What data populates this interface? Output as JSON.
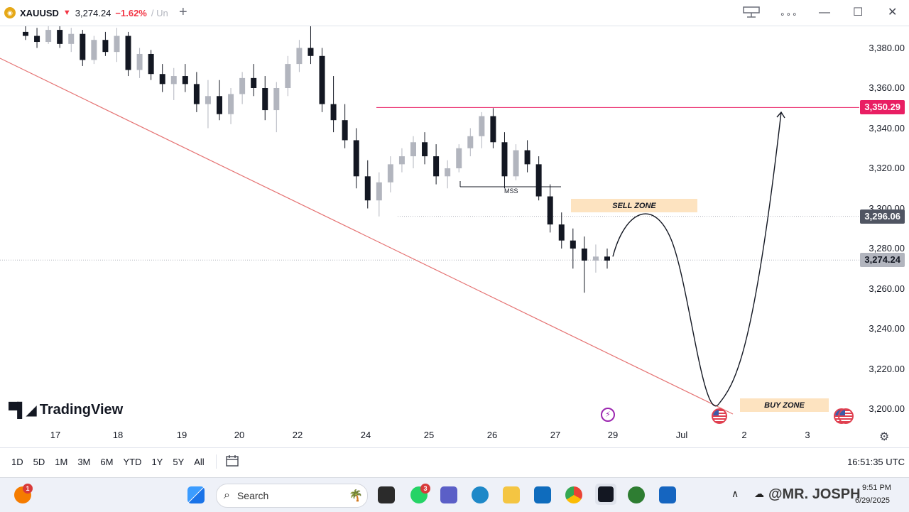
{
  "tab": {
    "symbol": "XAUUSD",
    "direction": "▼",
    "price": "3,274.24",
    "change": "−1.62%",
    "trailing": "/ Un",
    "new_tab": "+"
  },
  "window": {
    "layout_icon": "layout-icon",
    "more": "∘∘∘",
    "minimize": "—",
    "maximize": "☐",
    "close": "✕"
  },
  "chart": {
    "brand": "TradingView",
    "y_axis": {
      "min": 3190,
      "max": 3390,
      "ticks": [
        "3,380.00",
        "3,360.00",
        "3,340.00",
        "3,320.00",
        "3,300.00",
        "3,280.00",
        "3,260.00",
        "3,240.00",
        "3,220.00",
        "3,200.00"
      ],
      "tick_values": [
        3380,
        3360,
        3340,
        3320,
        3300,
        3280,
        3260,
        3240,
        3220,
        3200
      ]
    },
    "x_axis": {
      "labels": [
        "17",
        "18",
        "19",
        "20",
        "22",
        "24",
        "25",
        "26",
        "27",
        "29",
        "Jul",
        "2",
        "3"
      ]
    },
    "price_tags": {
      "resistance": {
        "text": "3,350.29",
        "value": 3350.29,
        "color": "#e91e63"
      },
      "target": {
        "text": "3,296.06",
        "value": 3296.06,
        "color": "#505562"
      },
      "last": {
        "text": "3,274.24",
        "value": 3274.24,
        "color": "#b2b5be"
      }
    },
    "annotations": {
      "sell_zone": "SELL ZONE",
      "buy_zone": "BUY ZONE",
      "mss": "MSS"
    }
  },
  "chart_data": {
    "type": "candlestick",
    "title": "",
    "symbol": "XAUUSD",
    "ylim": [
      3190,
      3390
    ],
    "horizontal_levels": [
      3350.29,
      3296.06,
      3274.24
    ],
    "candles_ohlc": [
      [
        3388,
        3392,
        3384,
        3386
      ],
      [
        3386,
        3390,
        3380,
        3383
      ],
      [
        3383,
        3392,
        3382,
        3389
      ],
      [
        3389,
        3391,
        3380,
        3382
      ],
      [
        3382,
        3390,
        3378,
        3387
      ],
      [
        3387,
        3389,
        3371,
        3374
      ],
      [
        3374,
        3386,
        3372,
        3384
      ],
      [
        3384,
        3388,
        3376,
        3378
      ],
      [
        3378,
        3390,
        3373,
        3386
      ],
      [
        3386,
        3388,
        3366,
        3369
      ],
      [
        3369,
        3380,
        3365,
        3377
      ],
      [
        3377,
        3379,
        3364,
        3367
      ],
      [
        3367,
        3372,
        3358,
        3362
      ],
      [
        3362,
        3370,
        3354,
        3366
      ],
      [
        3366,
        3372,
        3358,
        3362
      ],
      [
        3362,
        3368,
        3348,
        3352
      ],
      [
        3352,
        3364,
        3340,
        3356
      ],
      [
        3356,
        3364,
        3344,
        3347
      ],
      [
        3347,
        3360,
        3342,
        3357
      ],
      [
        3357,
        3368,
        3352,
        3365
      ],
      [
        3365,
        3372,
        3356,
        3360
      ],
      [
        3360,
        3366,
        3344,
        3349
      ],
      [
        3349,
        3363,
        3338,
        3360
      ],
      [
        3360,
        3376,
        3356,
        3372
      ],
      [
        3372,
        3384,
        3368,
        3380
      ],
      [
        3380,
        3392,
        3372,
        3376
      ],
      [
        3376,
        3380,
        3348,
        3352
      ],
      [
        3352,
        3366,
        3338,
        3344
      ],
      [
        3344,
        3352,
        3330,
        3334
      ],
      [
        3334,
        3340,
        3310,
        3316
      ],
      [
        3316,
        3324,
        3300,
        3304
      ],
      [
        3304,
        3318,
        3296,
        3313
      ],
      [
        3313,
        3326,
        3308,
        3322
      ],
      [
        3322,
        3330,
        3318,
        3326
      ],
      [
        3326,
        3336,
        3320,
        3333
      ],
      [
        3333,
        3338,
        3322,
        3326
      ],
      [
        3326,
        3332,
        3312,
        3316
      ],
      [
        3316,
        3324,
        3310,
        3320
      ],
      [
        3320,
        3332,
        3318,
        3330
      ],
      [
        3330,
        3340,
        3326,
        3336
      ],
      [
        3336,
        3348,
        3330,
        3346
      ],
      [
        3346,
        3350,
        3330,
        3333
      ],
      [
        3333,
        3338,
        3310,
        3316
      ],
      [
        3316,
        3332,
        3314,
        3329
      ],
      [
        3329,
        3334,
        3318,
        3322
      ],
      [
        3322,
        3326,
        3304,
        3306
      ],
      [
        3306,
        3312,
        3288,
        3292
      ],
      [
        3292,
        3298,
        3280,
        3284
      ],
      [
        3284,
        3290,
        3270,
        3280
      ],
      [
        3280,
        3286,
        3258,
        3274
      ],
      [
        3274,
        3282,
        3268,
        3276
      ],
      [
        3276,
        3280,
        3270,
        3274
      ]
    ],
    "projection": "price path drawn from last close up to sell zone near 3,296.06, down to buy zone near 3,200, then up to 3,350.29",
    "sell_zone": [
      3296.06,
      3302
    ],
    "buy_zone": [
      3198,
      3204
    ],
    "trendline": "descending red line from top-left to buy zone",
    "x_labels": [
      "17",
      "18",
      "19",
      "20",
      "22",
      "24",
      "25",
      "26",
      "27",
      "29",
      "Jul",
      "2",
      "3"
    ]
  },
  "toolbar": {
    "ranges": [
      "1D",
      "5D",
      "1M",
      "3M",
      "6M",
      "YTD",
      "1Y",
      "5Y",
      "All"
    ],
    "calendar_icon": "calendar-range-icon",
    "clock": "16:51:35 UTC"
  },
  "taskbar": {
    "search_placeholder": "Search",
    "notifications_badge": "1",
    "whatsapp_badge": "3",
    "time": "9:51 PM",
    "date": "6/29/2025",
    "watermark": "@MR. JOSPH"
  },
  "colors": {
    "bull": "#b2b5be",
    "bear": "#131722",
    "trend": "#e57373",
    "zone": "#fde3c0",
    "accent": "#e91e63"
  }
}
